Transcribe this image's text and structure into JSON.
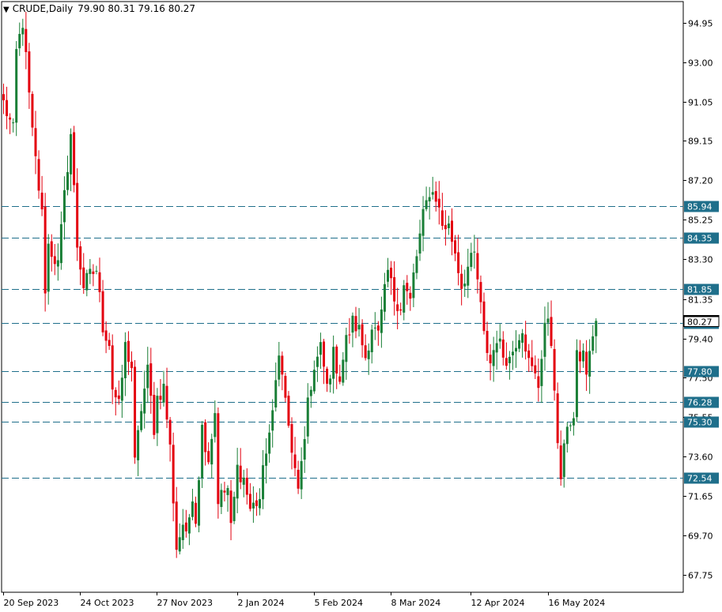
{
  "header": {
    "symbol_timeframe": "CRUDE,Daily",
    "ohlc": "79.90 80.31 79.16 80.27",
    "dropdown_icon": "triangle-down-icon"
  },
  "colors": {
    "bull": "#1a7f37",
    "bear": "#e3000f",
    "level_line": "#1f6f8b",
    "level_badge": "#1f6f8b",
    "current_price_badge": "#ffffff",
    "axis": "#000000"
  },
  "chart_data": {
    "type": "candlestick",
    "symbol": "CRUDE",
    "timeframe": "Daily",
    "ylim": [
      66.9,
      96.0
    ],
    "xlim_bars": [
      0,
      215
    ],
    "grid": false,
    "y_ticks": [
      "94.95",
      "93.00",
      "91.05",
      "89.15",
      "87.20",
      "85.25",
      "83.30",
      "81.35",
      "79.40",
      "77.50",
      "75.55",
      "73.60",
      "71.65",
      "69.70",
      "67.75"
    ],
    "x_ticks": [
      {
        "label": "20 Sep 2023",
        "bar": 0
      },
      {
        "label": "24 Oct 2023",
        "bar": 24
      },
      {
        "label": "27 Nov 2023",
        "bar": 48
      },
      {
        "label": "2 Jan 2024",
        "bar": 73
      },
      {
        "label": "5 Feb 2024",
        "bar": 97
      },
      {
        "label": "8 Mar 2024",
        "bar": 121
      },
      {
        "label": "12 Apr 2024",
        "bar": 146
      },
      {
        "label": "16 May 2024",
        "bar": 170
      }
    ],
    "levels": [
      {
        "label": "85.94",
        "value": 85.94
      },
      {
        "label": "84.35",
        "value": 84.35
      },
      {
        "label": "81.85",
        "value": 81.85
      },
      {
        "label": "80.15",
        "value": 80.15
      },
      {
        "label": "77.80",
        "value": 77.8
      },
      {
        "label": "76.28",
        "value": 76.28
      },
      {
        "label": "75.30",
        "value": 75.3
      },
      {
        "label": "72.54",
        "value": 72.54
      }
    ],
    "current_price": {
      "value": 80.27,
      "label": "80.27"
    },
    "anchors": [
      [
        0,
        91.0
      ],
      [
        3,
        89.6
      ],
      [
        4,
        93.5
      ],
      [
        6,
        95.0
      ],
      [
        9,
        89.5
      ],
      [
        12,
        85.5
      ],
      [
        13,
        81.9
      ],
      [
        14,
        84.0
      ],
      [
        17,
        83.0
      ],
      [
        19,
        86.4
      ],
      [
        21,
        89.5
      ],
      [
        23,
        84.0
      ],
      [
        25,
        82.0
      ],
      [
        27,
        82.5
      ],
      [
        29,
        82.8
      ],
      [
        31,
        80.0
      ],
      [
        33,
        79.2
      ],
      [
        34,
        77.0
      ],
      [
        36,
        76.0
      ],
      [
        38,
        79.0
      ],
      [
        40,
        78.0
      ],
      [
        41,
        73.2
      ],
      [
        43,
        76.0
      ],
      [
        45,
        77.8
      ],
      [
        47,
        75.0
      ],
      [
        48,
        76.5
      ],
      [
        50,
        77.0
      ],
      [
        52,
        74.0
      ],
      [
        53,
        71.5
      ],
      [
        54,
        69.1
      ],
      [
        56,
        70.3
      ],
      [
        57,
        69.5
      ],
      [
        59,
        71.8
      ],
      [
        60,
        70.5
      ],
      [
        62,
        75.0
      ],
      [
        64,
        73.5
      ],
      [
        66,
        75.8
      ],
      [
        67,
        71.5
      ],
      [
        70,
        72.0
      ],
      [
        71,
        70.0
      ],
      [
        73,
        73.0
      ],
      [
        75,
        72.5
      ],
      [
        77,
        71.0
      ],
      [
        80,
        71.5
      ],
      [
        82,
        74.0
      ],
      [
        84,
        75.5
      ],
      [
        86,
        79.0
      ],
      [
        87,
        77.5
      ],
      [
        89,
        75.2
      ],
      [
        90,
        73.5
      ],
      [
        92,
        72.2
      ],
      [
        94,
        74.0
      ],
      [
        95,
        76.5
      ],
      [
        97,
        77.8
      ],
      [
        99,
        78.9
      ],
      [
        101,
        77.0
      ],
      [
        103,
        78.6
      ],
      [
        105,
        77.5
      ],
      [
        107,
        79.3
      ],
      [
        109,
        80.2
      ],
      [
        111,
        79.8
      ],
      [
        113,
        78.5
      ],
      [
        115,
        80.0
      ],
      [
        117,
        79.5
      ],
      [
        120,
        82.7
      ],
      [
        122,
        81.4
      ],
      [
        124,
        81.0
      ],
      [
        125,
        82.0
      ],
      [
        127,
        81.2
      ],
      [
        128,
        82.5
      ],
      [
        131,
        85.4
      ],
      [
        133,
        86.7
      ],
      [
        135,
        86.4
      ],
      [
        137,
        85.0
      ],
      [
        139,
        84.9
      ],
      [
        141,
        83.7
      ],
      [
        143,
        82.0
      ],
      [
        145,
        82.9
      ],
      [
        147,
        83.5
      ],
      [
        148,
        82.3
      ],
      [
        150,
        79.5
      ],
      [
        152,
        78.2
      ],
      [
        154,
        79.5
      ],
      [
        156,
        78.6
      ],
      [
        158,
        78.4
      ],
      [
        160,
        79.3
      ],
      [
        162,
        80.0
      ],
      [
        164,
        78.2
      ],
      [
        166,
        77.5
      ],
      [
        167,
        77.1
      ],
      [
        169,
        80.2
      ],
      [
        170,
        80.0
      ],
      [
        171,
        79.2
      ],
      [
        172,
        77.2
      ],
      [
        173,
        73.9
      ],
      [
        174,
        72.6
      ],
      [
        175,
        73.8
      ],
      [
        176,
        75.3
      ],
      [
        178,
        75.4
      ],
      [
        179,
        78.4
      ],
      [
        181,
        78.6
      ],
      [
        182,
        77.8
      ],
      [
        183,
        78.5
      ],
      [
        184,
        79.7
      ],
      [
        185,
        80.27
      ]
    ]
  }
}
